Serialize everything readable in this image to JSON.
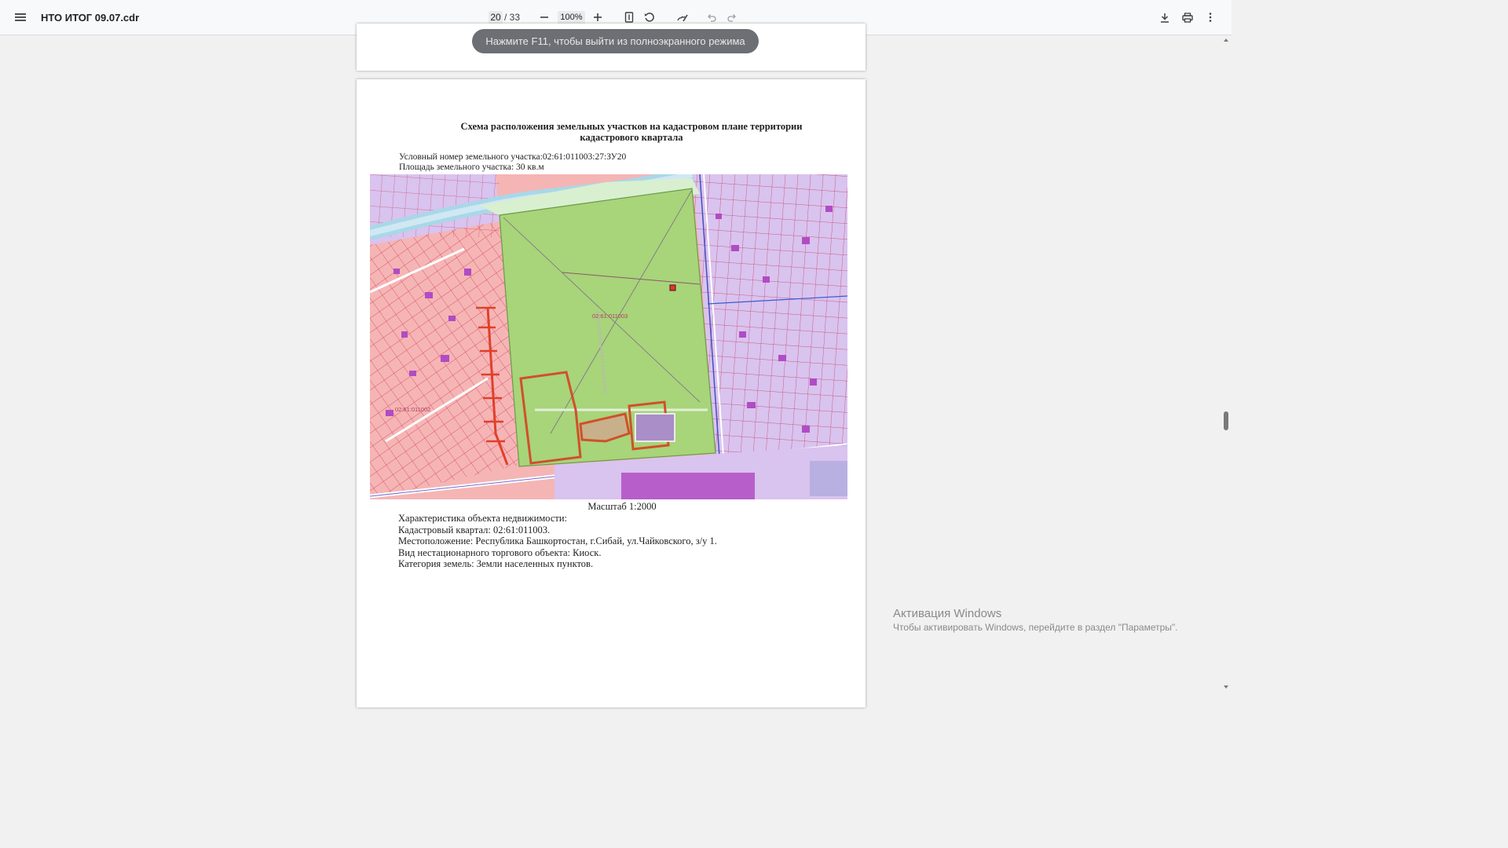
{
  "toolbar": {
    "title": "НТО ИТОГ 09.07.cdr",
    "page_current": "20",
    "page_total": "/ 33",
    "zoom": "100%"
  },
  "toast": "Нажмите F11, чтобы выйти из полноэкранного режима",
  "document": {
    "heading_line1": "Схема расположения земельных участков на кадастровом плане территории",
    "heading_line2": "кадастрового квартала",
    "plot_number": "Условный номер земельного участка:02:61:011003:27:ЗУ20",
    "plot_area": "Площадь земельного участка: 30 кв.м",
    "map_labels": {
      "quarter_main": "02:61:011003",
      "quarter_left": "02:61:011002"
    },
    "scale": "Масштаб 1:2000",
    "characteristics": [
      "Характеристика объекта недвижимости:",
      "Кадастровый квартал: 02:61:011003.",
      "Местоположение: Республика Башкортостан, г.Сибай, ул.Чайковского, з/у 1.",
      "Вид нестационарного торгового объекта: Киоск.",
      "Категория земель: Земли населенных пунктов."
    ]
  },
  "windows_watermark": {
    "title": "Активация Windows",
    "subtitle": "Чтобы активировать Windows, перейдите в раздел \"Параметры\"."
  },
  "colors": {
    "toolbar_bg": "#f8f9fa",
    "viewer_bg": "#f1f1f1",
    "park_green": "#a8d47a",
    "zone_pink": "#f5b5b5",
    "zone_lilac": "#d9c3ef",
    "plot_marker": "#e8322a"
  },
  "icons": [
    "menu-icon",
    "zoom-out-icon",
    "zoom-in-icon",
    "fit-page-icon",
    "rotate-icon",
    "annotate-icon",
    "undo-icon",
    "redo-icon",
    "download-icon",
    "print-icon",
    "more-vert-icon"
  ]
}
